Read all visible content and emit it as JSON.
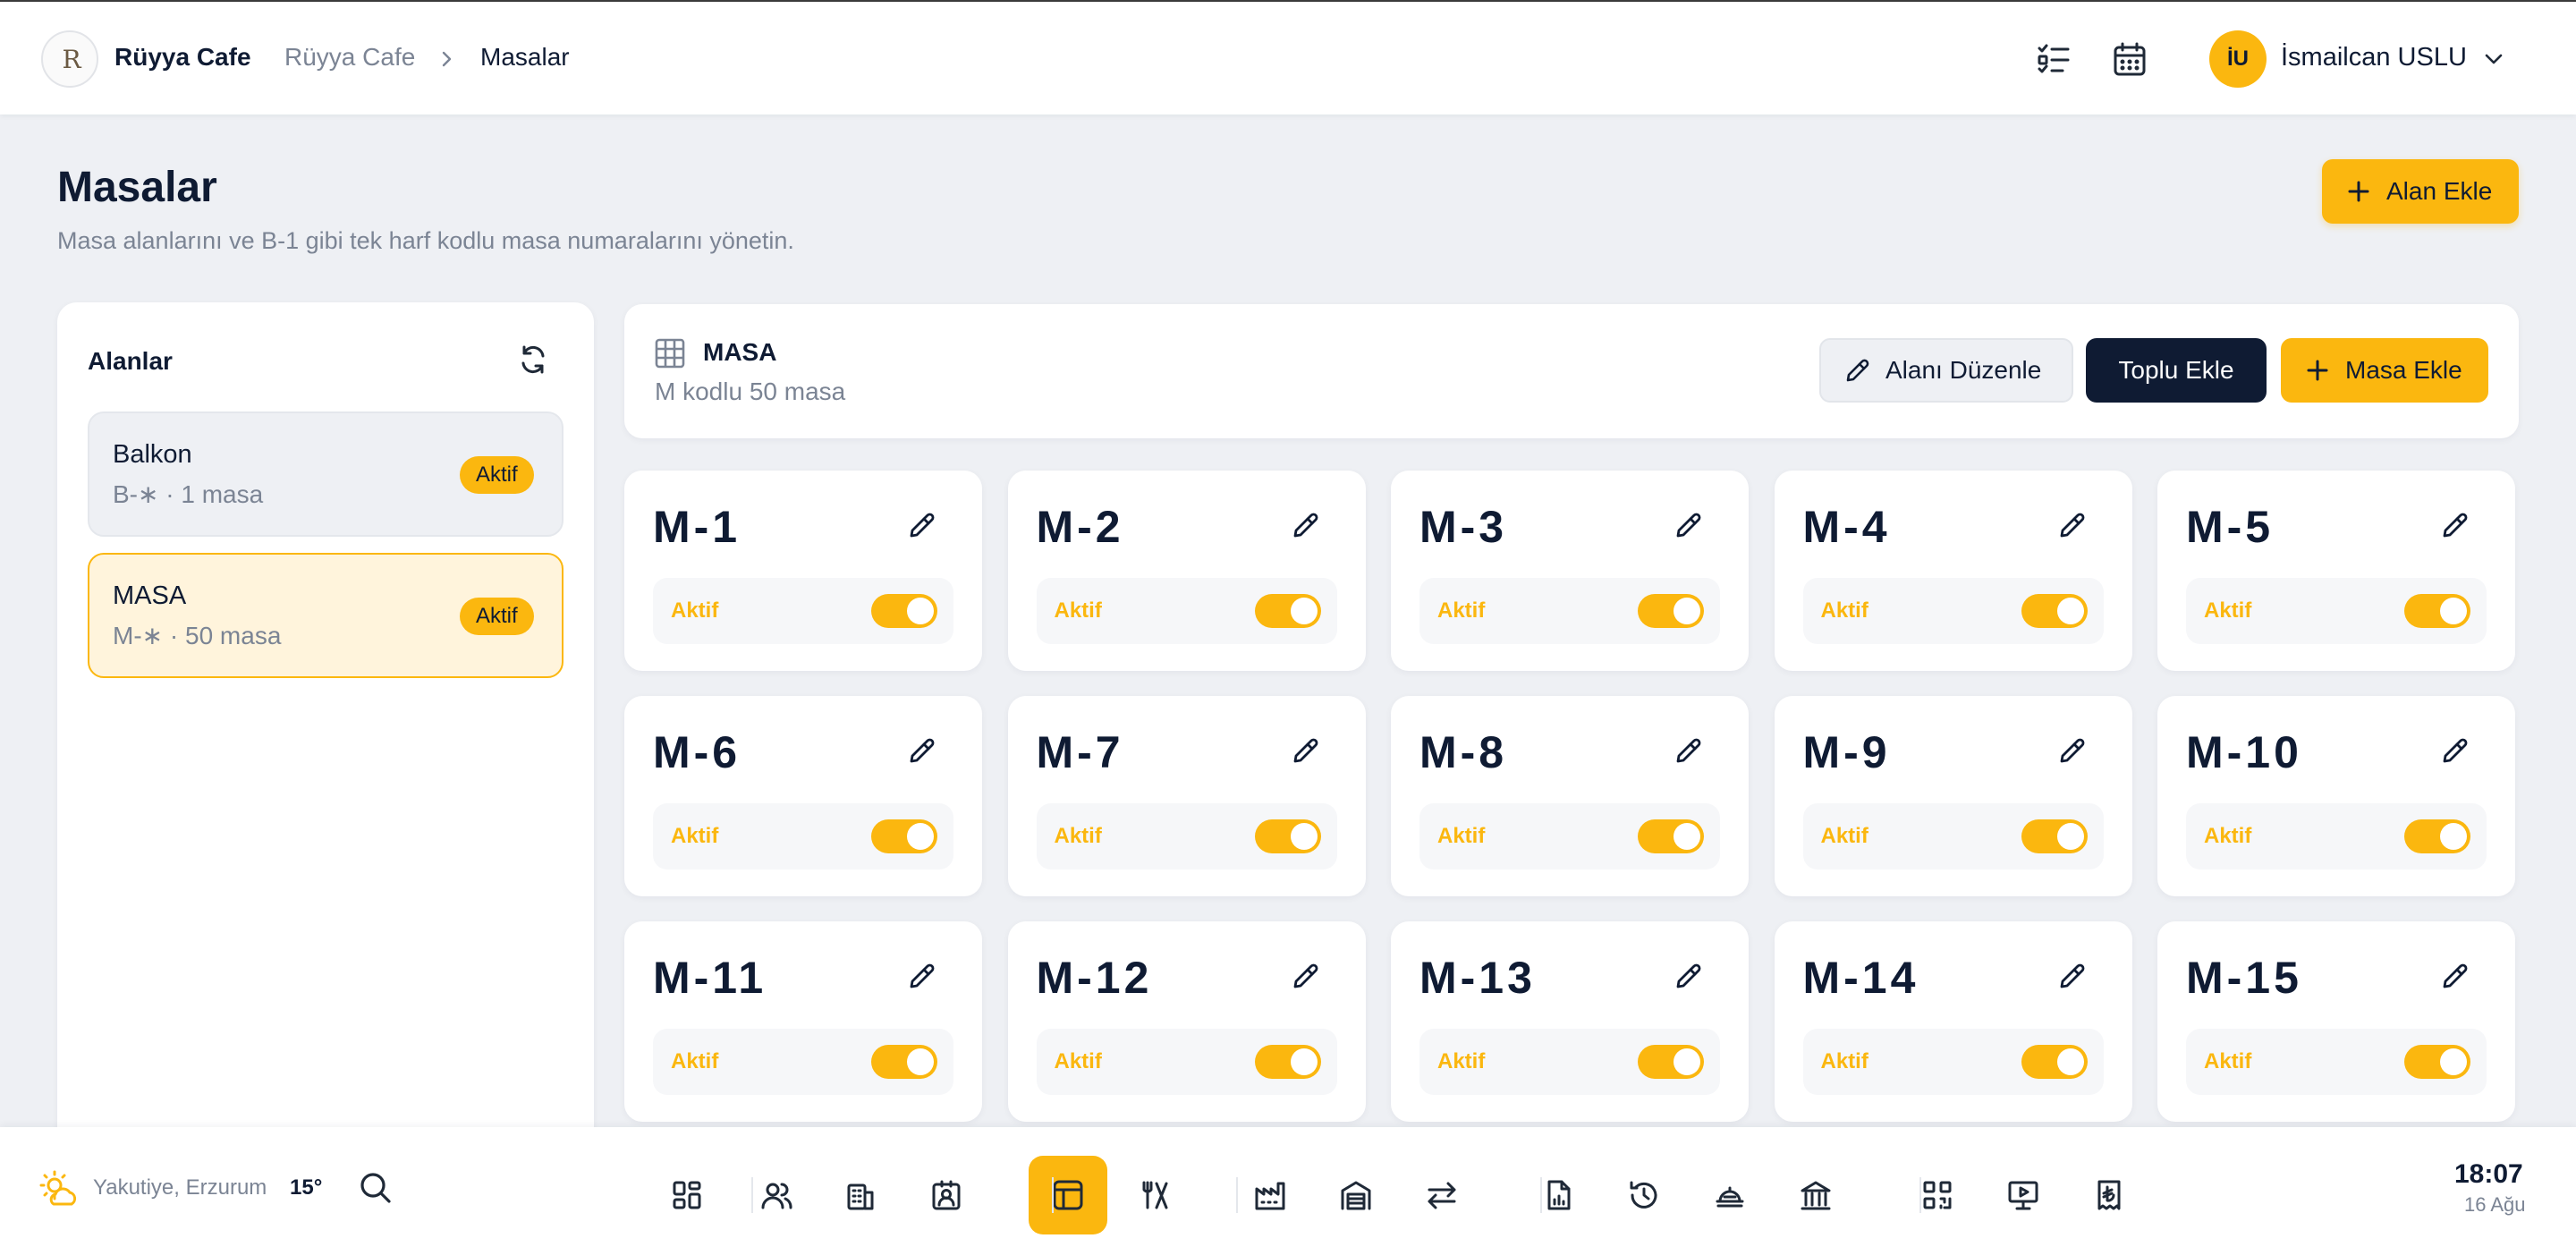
{
  "header": {
    "brand": "Rüyya Cafe",
    "logo_text": "R",
    "breadcrumb": [
      "Rüyya Cafe",
      "Masalar"
    ],
    "user": {
      "initials": "İU",
      "name": "İsmailcan USLU"
    }
  },
  "page": {
    "title": "Masalar",
    "subtitle": "Masa alanlarını ve B-1 gibi tek harf kodlu masa numaralarını yönetin.",
    "add_area_label": "Alan Ekle"
  },
  "areas_panel": {
    "title": "Alanlar",
    "items": [
      {
        "name": "Balkon",
        "meta": "B-∗ · 1 masa",
        "badge": "Aktif",
        "selected": false
      },
      {
        "name": "MASA",
        "meta": "M-∗ · 50 masa",
        "badge": "Aktif",
        "selected": true
      }
    ]
  },
  "area_detail": {
    "title": "MASA",
    "subtitle": "M kodlu 50 masa",
    "edit_label": "Alanı Düzenle",
    "bulk_add_label": "Toplu Ekle",
    "add_table_label": "Masa Ekle"
  },
  "tables": [
    {
      "code": "M-1",
      "status": "Aktif",
      "active": true
    },
    {
      "code": "M-2",
      "status": "Aktif",
      "active": true
    },
    {
      "code": "M-3",
      "status": "Aktif",
      "active": true
    },
    {
      "code": "M-4",
      "status": "Aktif",
      "active": true
    },
    {
      "code": "M-5",
      "status": "Aktif",
      "active": true
    },
    {
      "code": "M-6",
      "status": "Aktif",
      "active": true
    },
    {
      "code": "M-7",
      "status": "Aktif",
      "active": true
    },
    {
      "code": "M-8",
      "status": "Aktif",
      "active": true
    },
    {
      "code": "M-9",
      "status": "Aktif",
      "active": true
    },
    {
      "code": "M-10",
      "status": "Aktif",
      "active": true
    },
    {
      "code": "M-11",
      "status": "Aktif",
      "active": true
    },
    {
      "code": "M-12",
      "status": "Aktif",
      "active": true
    },
    {
      "code": "M-13",
      "status": "Aktif",
      "active": true
    },
    {
      "code": "M-14",
      "status": "Aktif",
      "active": true
    },
    {
      "code": "M-15",
      "status": "Aktif",
      "active": true
    }
  ],
  "bottom_bar": {
    "weather": {
      "location": "Yakutiye, Erzurum",
      "temp": "15°"
    },
    "clock": {
      "time": "18:07",
      "date": "16 Ağu"
    },
    "dock": [
      {
        "icon": "dashboard-grid-icon"
      },
      {
        "icon": "users-icon"
      },
      {
        "icon": "building-icon"
      },
      {
        "icon": "staff-badge-icon"
      },
      {
        "icon": "table-layout-icon",
        "active": true
      },
      {
        "icon": "utensils-icon"
      },
      {
        "icon": "factory-icon"
      },
      {
        "icon": "warehouse-icon"
      },
      {
        "icon": "transfer-arrows-icon"
      },
      {
        "icon": "report-file-icon"
      },
      {
        "icon": "history-icon"
      },
      {
        "icon": "cloche-icon"
      },
      {
        "icon": "bank-icon"
      },
      {
        "icon": "qr-code-icon"
      },
      {
        "icon": "presentation-icon"
      },
      {
        "icon": "lira-receipt-icon"
      }
    ]
  },
  "colors": {
    "accent": "#fbb70f",
    "dark": "#0f1b33",
    "muted": "#7b8494",
    "background": "#eef0f4",
    "selected_bg": "#fff4dc"
  }
}
